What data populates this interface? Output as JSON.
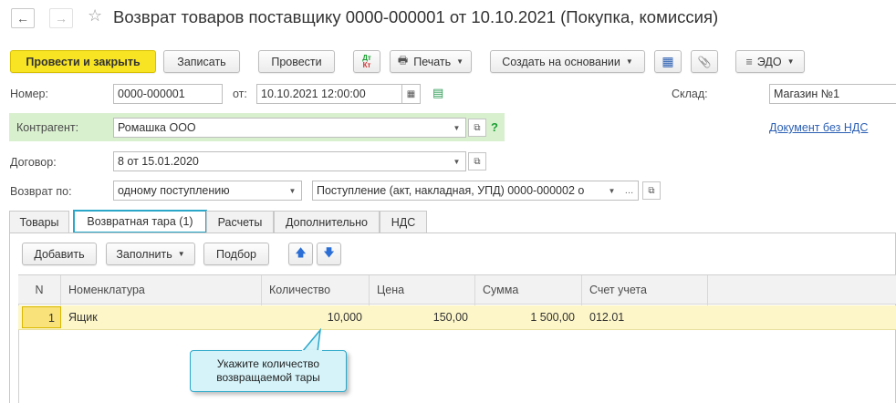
{
  "window": {
    "title": "Возврат товаров поставщику 0000-000001 от 10.10.2021 (Покупка, комиссия)"
  },
  "icons": {
    "back": "←",
    "forward": "→",
    "favorite": "☆",
    "dtkt_top": "Дт",
    "dtkt_bottom": "Кт",
    "print": "🖶",
    "structure": "▦",
    "attach": "📎",
    "edo": "≡",
    "calendar": "▦",
    "doc_status": "▤",
    "open": "⧉",
    "caret": "▼",
    "help": "?",
    "up": "🡅",
    "down": "🡇"
  },
  "toolbar": {
    "post_close": "Провести и закрыть",
    "save": "Записать",
    "post": "Провести",
    "print": "Печать",
    "create_based": "Создать на основании",
    "edo": "ЭДО"
  },
  "form": {
    "number_label": "Номер:",
    "number_value": "0000-000001",
    "date_label": "от:",
    "date_value": "10.10.2021 12:00:00",
    "warehouse_label": "Склад:",
    "warehouse_value": "Магазин №1",
    "counterparty_label": "Контрагент:",
    "counterparty_value": "Ромашка ООО",
    "vat_link": "Документ без НДС",
    "contract_label": "Договор:",
    "contract_value": "8 от 15.01.2020",
    "return_by_label": "Возврат по:",
    "return_by_value": "одному поступлению",
    "receipt_value": "Поступление (акт, накладная, УПД) 0000-000002 о"
  },
  "tabs": [
    {
      "label": "Товары"
    },
    {
      "label": "Возвратная тара (1)"
    },
    {
      "label": "Расчеты"
    },
    {
      "label": "Дополнительно"
    },
    {
      "label": "НДС"
    }
  ],
  "table_toolbar": {
    "add": "Добавить",
    "fill": "Заполнить",
    "select": "Подбор"
  },
  "table": {
    "columns": [
      "N",
      "Номенклатура",
      "Количество",
      "Цена",
      "Сумма",
      "Счет учета"
    ],
    "rows": [
      {
        "n": "1",
        "item": "Ящик",
        "qty": "10,000",
        "price": "150,00",
        "sum": "1 500,00",
        "account": "012.01"
      }
    ]
  },
  "tooltip": {
    "line1": "Укажите количество",
    "line2": "возвращаемой тары"
  },
  "colors": {
    "accent": "#2aa7c9",
    "primary_button": "#f8e423",
    "row_highlight": "#fdf6c8",
    "counterparty_bg": "#d9f0cf",
    "link": "#2b5fb3"
  }
}
